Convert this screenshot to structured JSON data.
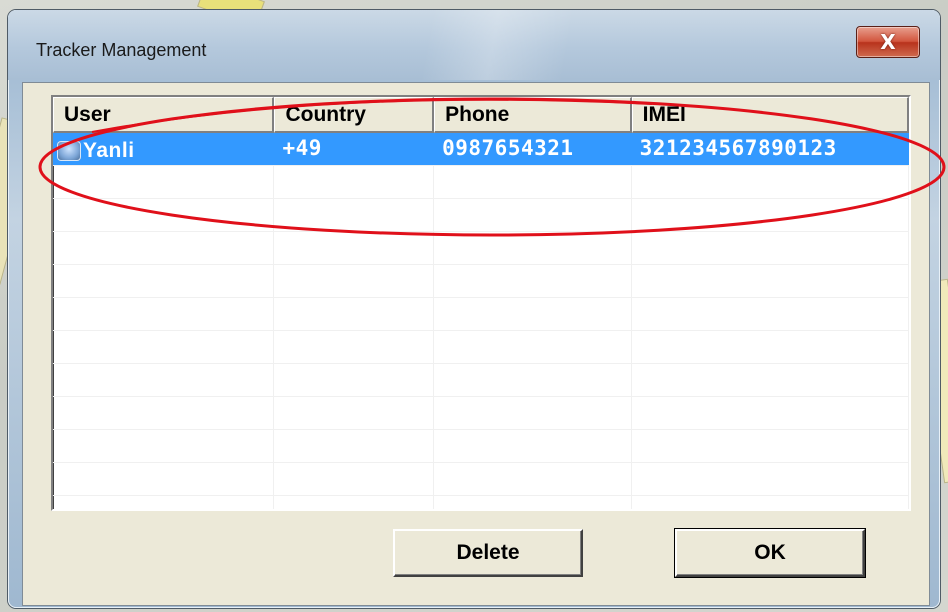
{
  "window": {
    "title": "Tracker Management",
    "close_glyph": "X"
  },
  "list": {
    "columns": [
      "User",
      "Country",
      "Phone",
      "IMEI"
    ],
    "rows": [
      {
        "user": "Yanli",
        "country": "+49",
        "phone": "0987654321",
        "imei": "321234567890123",
        "selected": true,
        "icon": "user-icon"
      }
    ]
  },
  "buttons": {
    "delete_label": "Delete",
    "ok_label": "OK"
  },
  "colors": {
    "selection": "#3399ff",
    "annotation": "#e0101a",
    "dialog_face": "#ece9d8"
  }
}
